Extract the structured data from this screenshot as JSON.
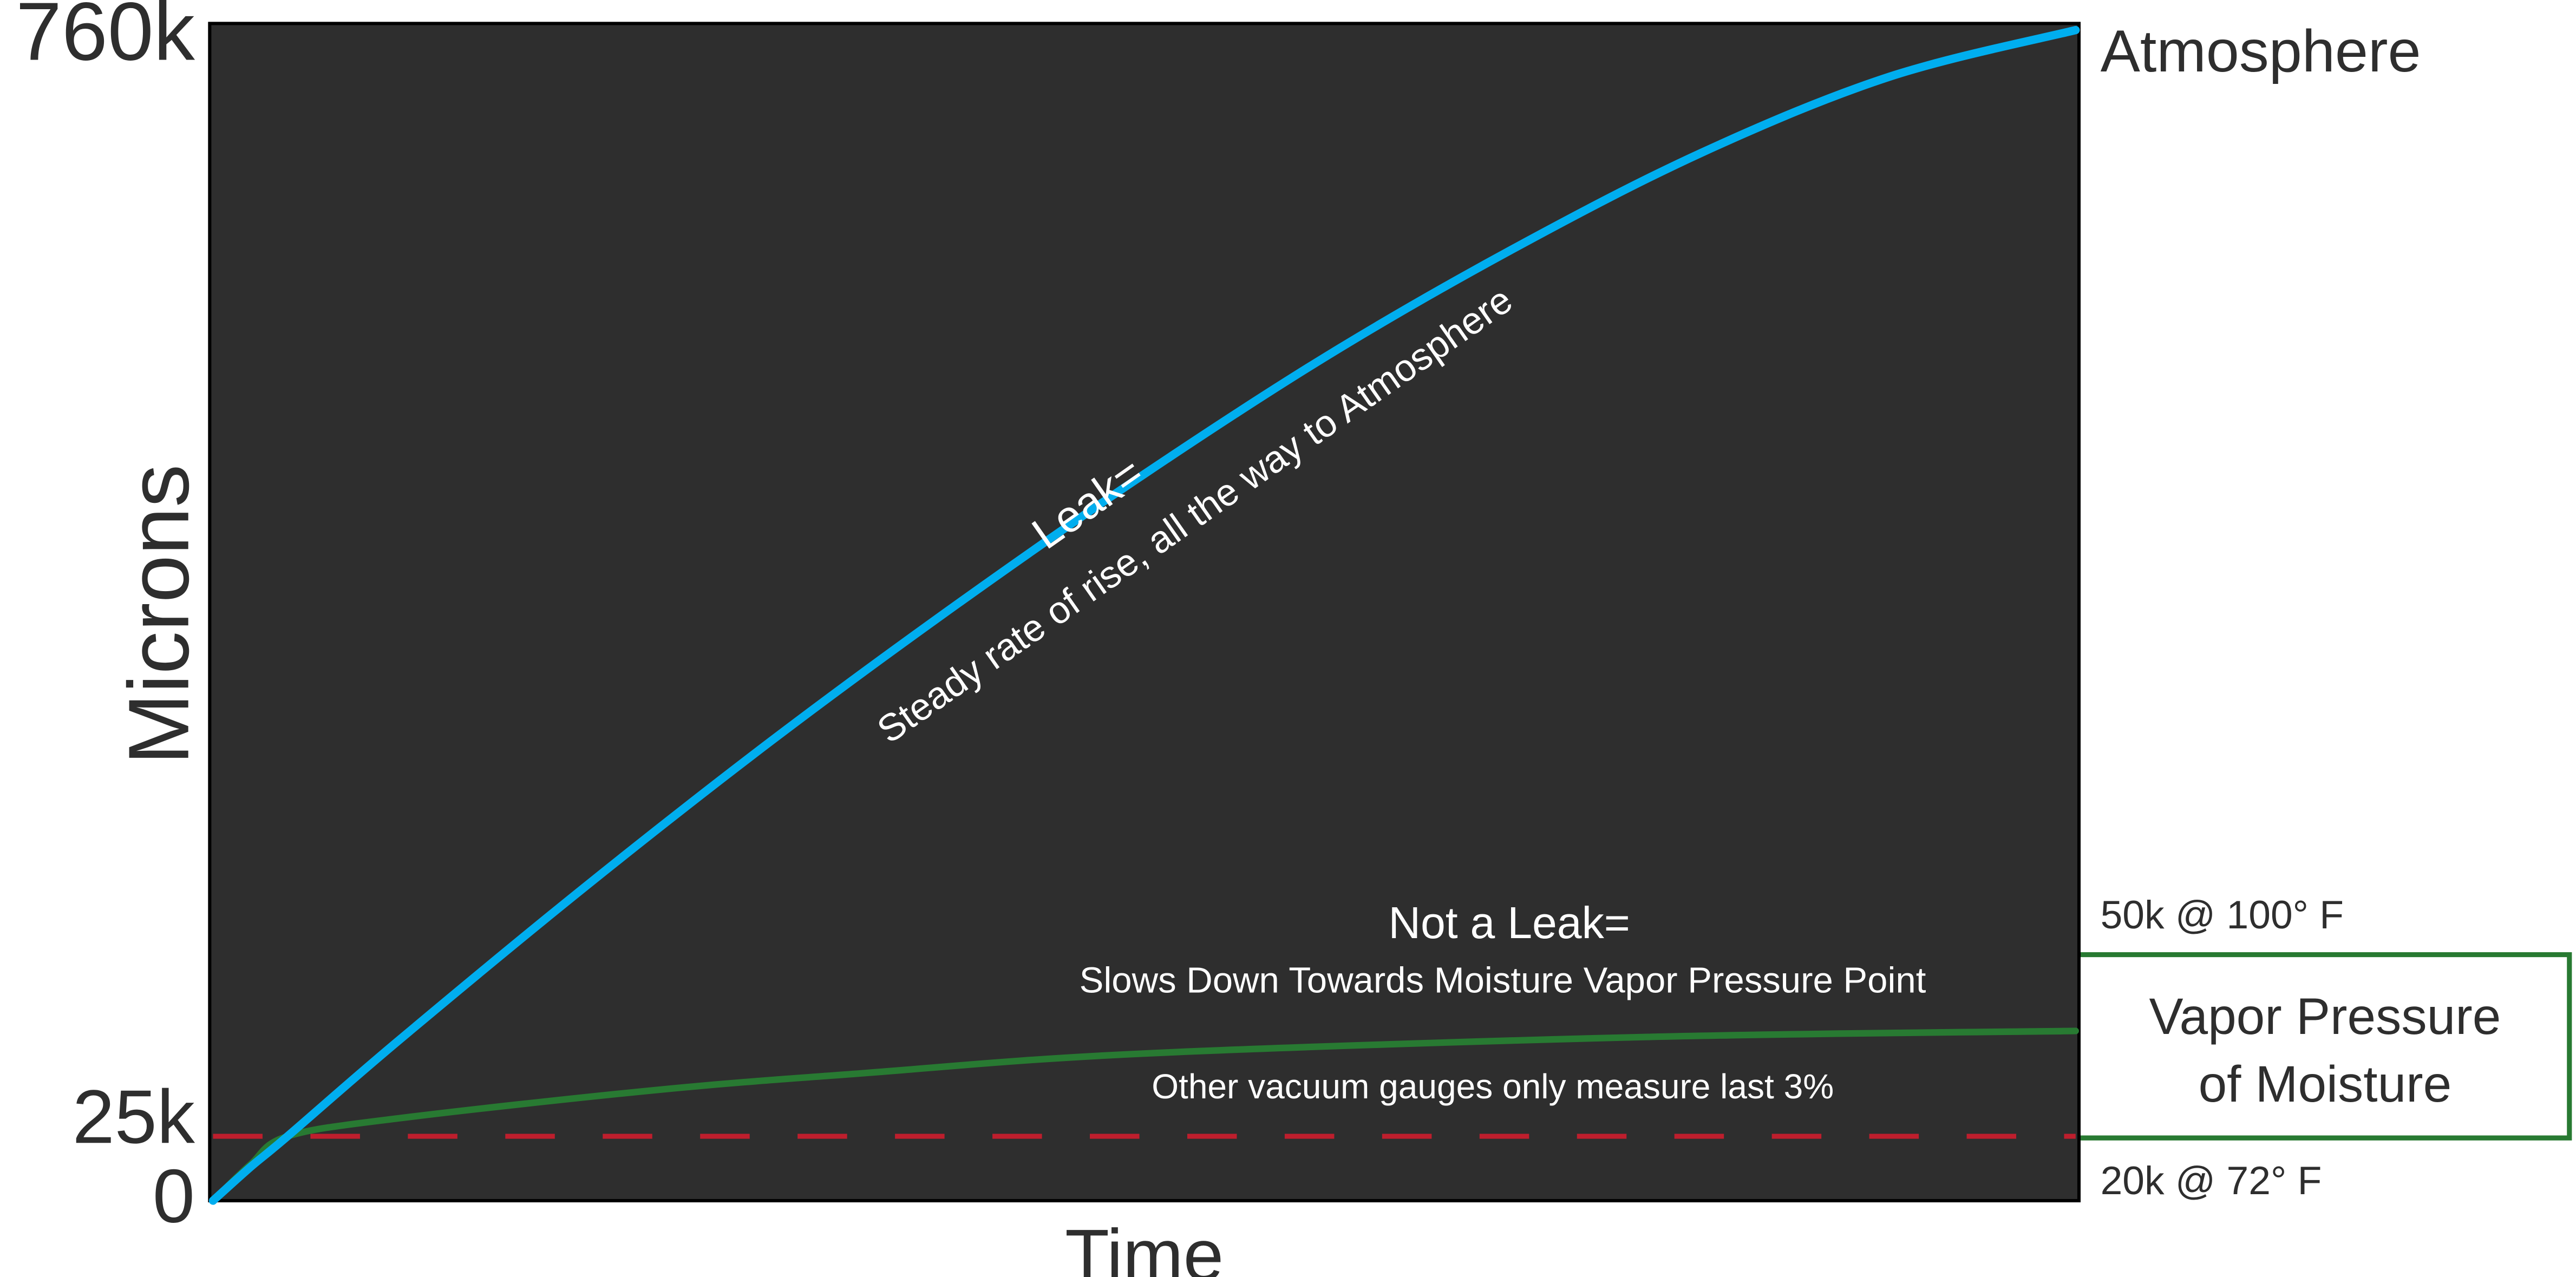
{
  "chart_data": {
    "type": "line",
    "title": "",
    "xlabel": "Time",
    "ylabel": "Microns",
    "ylim": [
      0,
      760000
    ],
    "y_ticks": [
      {
        "value": 0,
        "label": "0"
      },
      {
        "value": 25000,
        "label": "25k"
      },
      {
        "value": 760000,
        "label": "760k"
      }
    ],
    "xlim": [
      0,
      100
    ],
    "grid": false,
    "background_color": "#2e2e2e",
    "series": [
      {
        "color": "#00aeef",
        "x": [
          0,
          2,
          4,
          10,
          20,
          30,
          40,
          50,
          60,
          70,
          80,
          90,
          100
        ],
        "y": [
          0,
          13000,
          25000,
          89000,
          191000,
          288000,
          379000,
          465000,
          545000,
          616000,
          679000,
          729000,
          760000
        ]
      },
      {
        "color": "#287a32",
        "x": [
          0,
          2,
          4,
          10,
          24,
          35,
          50,
          77,
          100
        ],
        "y": [
          0,
          14000,
          25000,
          37000,
          56000,
          67000,
          80000,
          91000,
          95000
        ]
      }
    ],
    "reference_line": {
      "value": 25000,
      "style": "dashed",
      "color": "#be1e2d"
    },
    "annotations": {
      "leak_title": "Leak=",
      "leak_text": "Steady rate of rise, all the way to Atmosphere",
      "not_leak_title": "Not a Leak=",
      "not_leak_text": "Slows Down Towards Moisture Vapor Pressure Point",
      "gauges_text": "Other vacuum gauges only measure last 3%",
      "atmosphere": "Atmosphere",
      "vp_high": "50k @ 100° F",
      "vp_low": "20k @ 72° F",
      "vp_box_line1": "Vapor Pressure",
      "vp_box_line2": "of Moisture",
      "vp_box_color": "#287a32"
    }
  }
}
